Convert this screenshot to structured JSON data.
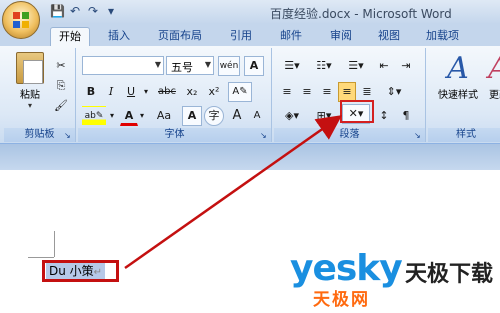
{
  "window": {
    "title": "百度经验.docx - Microsoft Word"
  },
  "qat": {
    "save_icon": "save-icon",
    "undo_icon": "undo-icon",
    "redo_icon": "redo-icon"
  },
  "tabs": [
    {
      "label": "开始",
      "active": true
    },
    {
      "label": "插入"
    },
    {
      "label": "页面布局"
    },
    {
      "label": "引用"
    },
    {
      "label": "邮件"
    },
    {
      "label": "审阅"
    },
    {
      "label": "视图"
    },
    {
      "label": "加载项"
    }
  ],
  "clipboard": {
    "paste_label": "粘贴",
    "group_label": "剪贴板"
  },
  "font": {
    "font_name": "",
    "font_size": "五号",
    "bold": "B",
    "italic": "I",
    "underline": "U",
    "strike": "abc",
    "subscript": "x₂",
    "superscript": "x²",
    "wen": "wén",
    "case": "Aa",
    "grow": "A",
    "shrink": "A",
    "char_border": "A",
    "enclose": "字",
    "group_label": "字体"
  },
  "paragraph": {
    "group_label": "段落"
  },
  "styles": {
    "quick_label": "快速样式",
    "change_label": "更改",
    "group_label": "样式"
  },
  "document": {
    "selected_text": "Du 小策",
    "para_mark": "↵"
  },
  "watermark": {
    "brand": "yesky",
    "cn_name": "天极下载",
    "cn_sub": "天极网"
  },
  "colors": {
    "accent": "#15428b",
    "highlight": "#c41010"
  }
}
